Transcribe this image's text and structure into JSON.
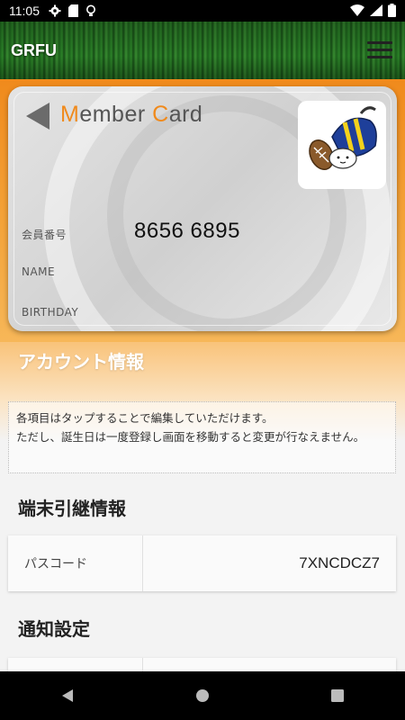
{
  "status_bar": {
    "time": "11:05"
  },
  "app_bar": {
    "title": "GRFU"
  },
  "member_card": {
    "title_prefix_m": "M",
    "title_part1": "ember ",
    "title_prefix_c": "C",
    "title_part2": "ard",
    "member_number_label": "会員番号",
    "member_number": "8656 6895",
    "name_label": "NAME",
    "birthday_label": "BIRTHDAY"
  },
  "account_section": {
    "title": "アカウント情報",
    "notice_line1": "各項目はタップすることで編集していただけます。",
    "notice_line2": "ただし、誕生日は一度登録し画面を移動すると変更が行なえません。"
  },
  "transfer_section": {
    "title": "端末引継情報",
    "passcode_label": "パスコード",
    "passcode_value": "7XNCDCZ7"
  },
  "notification_section": {
    "title": "通知設定"
  },
  "colors": {
    "accent": "#f08a1c",
    "grass": "#2f8a2b",
    "card": "#d9d9d9"
  }
}
